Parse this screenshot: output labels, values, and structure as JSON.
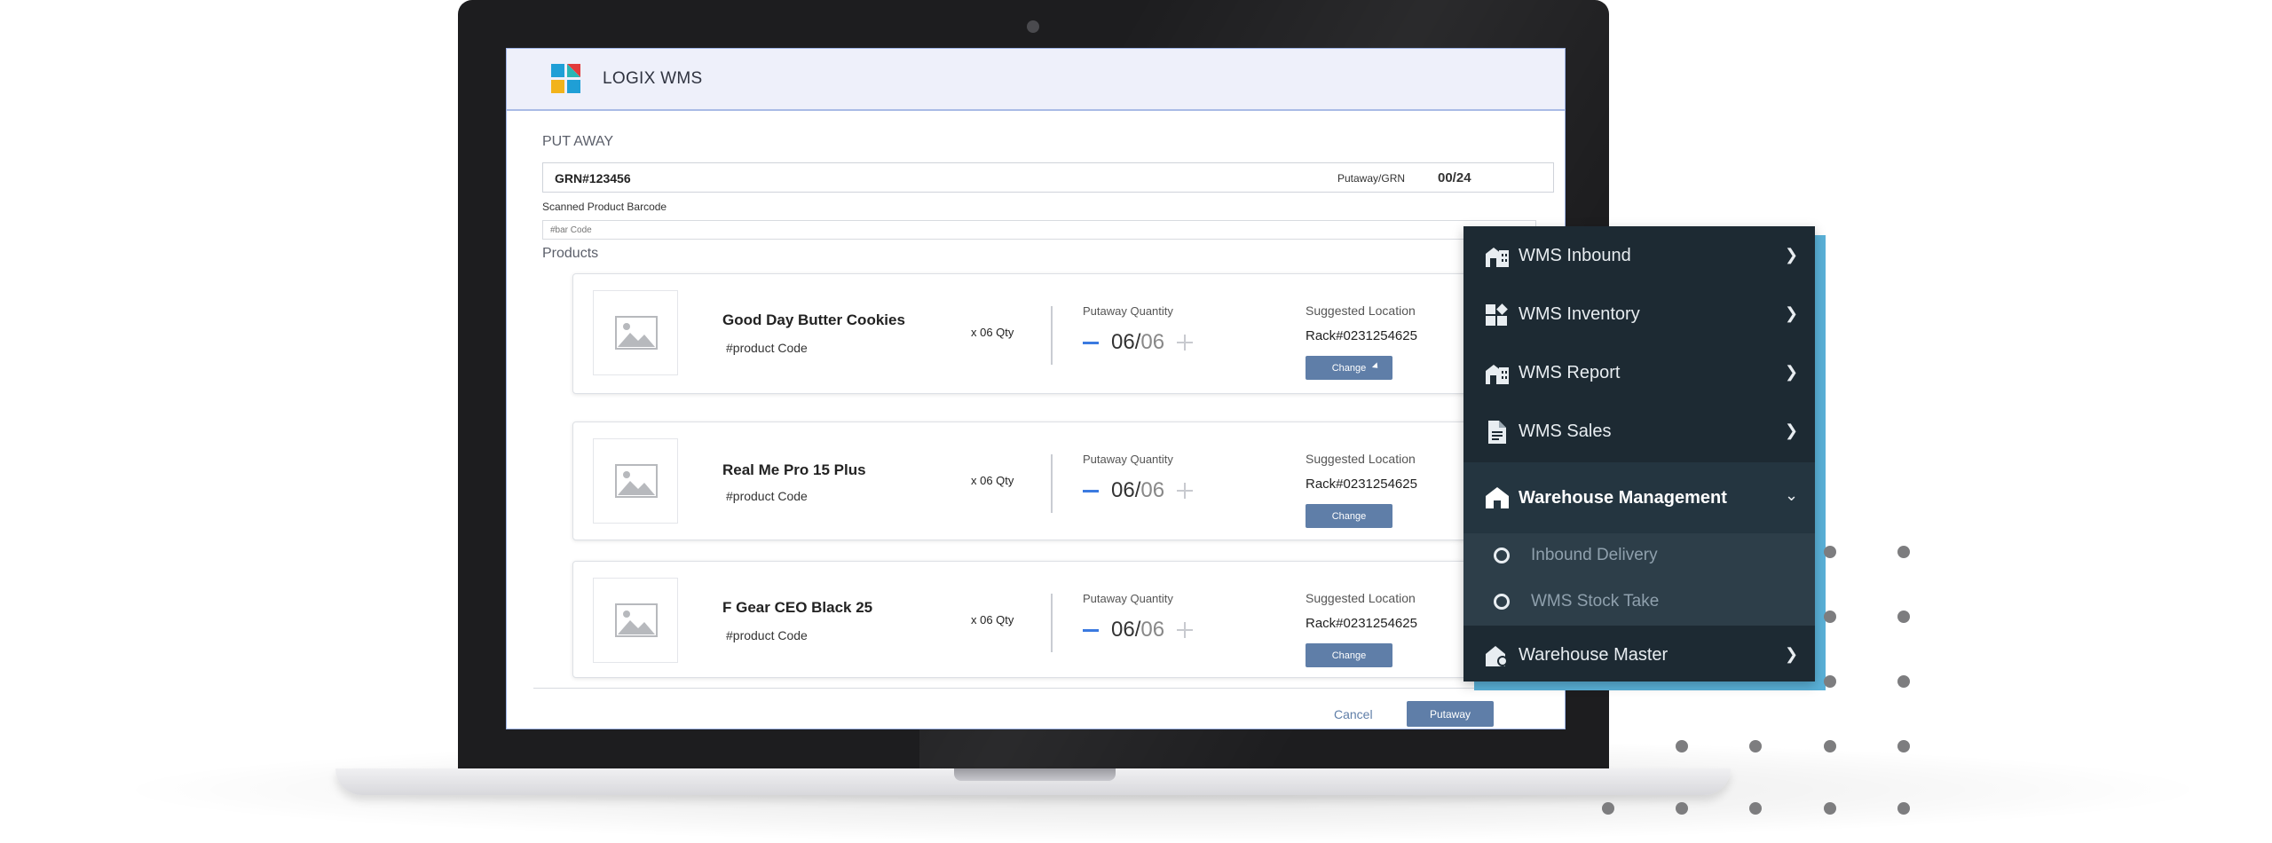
{
  "app": {
    "title": "LOGIX WMS"
  },
  "putaway": {
    "page_title": "PUT AWAY",
    "grn_number": "GRN#123456",
    "putaway_label": "Putaway/GRN",
    "putaway_count": "00/24",
    "barcode_label": "Scanned Product Barcode",
    "barcode_placeholder": "#bar Code",
    "products_heading": "Products",
    "products": [
      {
        "name": "Good Day Butter Cookies",
        "code": "#product Code",
        "qty": "x 06 Qty",
        "putaway_label": "Putaway Quantity",
        "qty_value": "06/",
        "qty_total": "06",
        "location_label": "Suggested Location",
        "location": "Rack#0231254625",
        "change_label": "Change"
      },
      {
        "name": "Real Me Pro 15 Plus",
        "code": "#product Code",
        "qty": "x 06 Qty",
        "putaway_label": "Putaway Quantity",
        "qty_value": "06/",
        "qty_total": "06",
        "location_label": "Suggested Location",
        "location": "Rack#0231254625",
        "change_label": "Change"
      },
      {
        "name": "F Gear CEO Black 25",
        "code": "#product Code",
        "qty": "x 06 Qty",
        "putaway_label": "Putaway Quantity",
        "qty_value": "06/",
        "qty_total": "06",
        "location_label": "Suggested Location",
        "location": "Rack#0231254625",
        "change_label": "Change"
      }
    ],
    "cancel_label": "Cancel",
    "putaway_button": "Putaway"
  },
  "menu": {
    "items": [
      {
        "label": "WMS Inbound",
        "icon": "warehouse-icon"
      },
      {
        "label": "WMS Inventory",
        "icon": "inventory-icon"
      },
      {
        "label": "WMS Report",
        "icon": "warehouse-icon"
      },
      {
        "label": "WMS Sales",
        "icon": "document-icon"
      },
      {
        "label": "Warehouse Management",
        "icon": "home-icon",
        "expanded": true
      },
      {
        "label": "Warehouse Master",
        "icon": "warehouse-master-icon"
      }
    ],
    "sub_items": [
      {
        "label": "Inbound Delivery"
      },
      {
        "label": "WMS Stock Take"
      }
    ]
  },
  "colors": {
    "menu_bg": "#1d2a33",
    "accent_blue": "#5ab1d8",
    "button": "#5f7ea8"
  }
}
